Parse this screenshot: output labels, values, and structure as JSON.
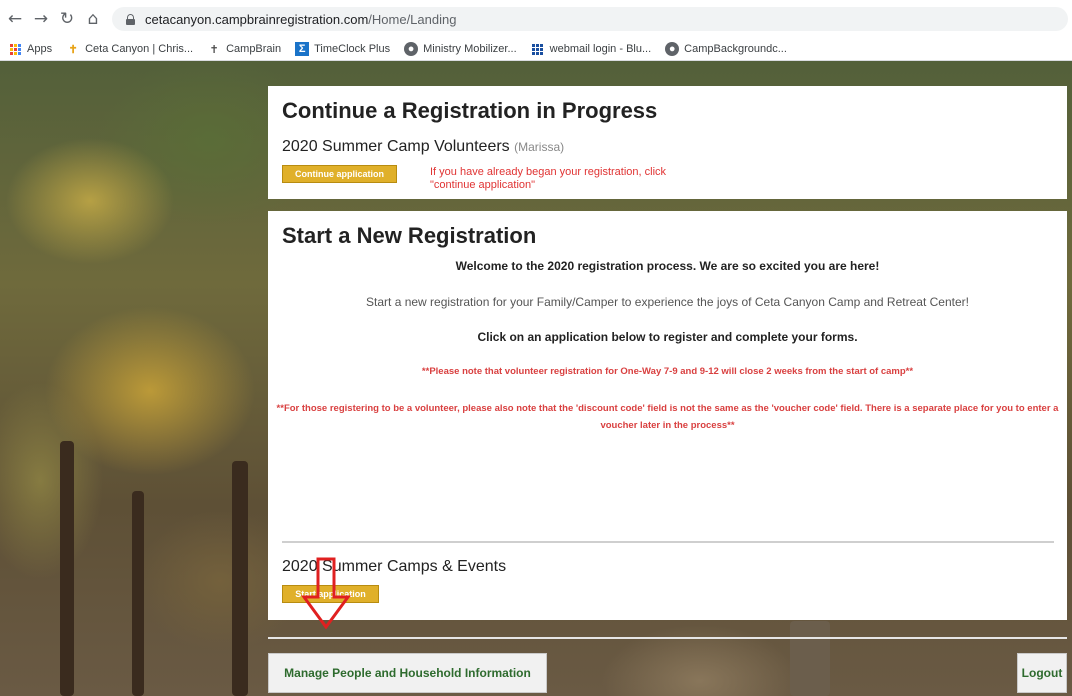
{
  "browser": {
    "url_domain": "cetacanyon.campbrainregistration.com",
    "url_path": "/Home/Landing",
    "bookmarks": [
      {
        "label": "Apps",
        "icon": "apps-grid-icon"
      },
      {
        "label": "Ceta Canyon | Chris...",
        "icon": "cross-icon"
      },
      {
        "label": "CampBrain",
        "icon": "campbrain-icon"
      },
      {
        "label": "TimeClock Plus",
        "icon": "timeclock-icon"
      },
      {
        "label": "Ministry Mobilizer...",
        "icon": "globe-icon"
      },
      {
        "label": "webmail login - Blu...",
        "icon": "grid-icon"
      },
      {
        "label": "CampBackgroundc...",
        "icon": "globe-icon"
      }
    ]
  },
  "continue_section": {
    "heading": "Continue a Registration in Progress",
    "registration_name": "2020 Summer Camp Volunteers",
    "registration_person": "(Marissa)",
    "button_label": "Continue application",
    "annotation_line1": "If you have already began your registration, click",
    "annotation_line2": "\"continue application\"",
    "annotation_color": "#e03333"
  },
  "new_section": {
    "heading": "Start a New Registration",
    "welcome": "Welcome to the 2020 registration process. We are so excited you are here!",
    "start_text": "Start a new registration for your Family/Camper to experience the joys of Ceta Canyon Camp and Retreat Center!",
    "click_text": "Click on an application below to register and complete your forms.",
    "note_volunteer": "**Please note that volunteer registration for One-Way 7-9 and 9-12 will close 2 weeks from the start of camp**",
    "note_discount": "**For those registering to be a volunteer, please also note that the 'discount code' field is not the same as the 'voucher code' field.  There is a separate place for you to enter a voucher later in the process**",
    "camp_title": "2020 Summer Camps & Events",
    "button_label": "Start application"
  },
  "footer": {
    "manage_label": "Manage People and Household Information",
    "logout_label": "Logout"
  },
  "colors": {
    "button_gold": "#e0b02a",
    "warning_red": "#d94040",
    "footer_text_green": "#2e6b2e"
  }
}
